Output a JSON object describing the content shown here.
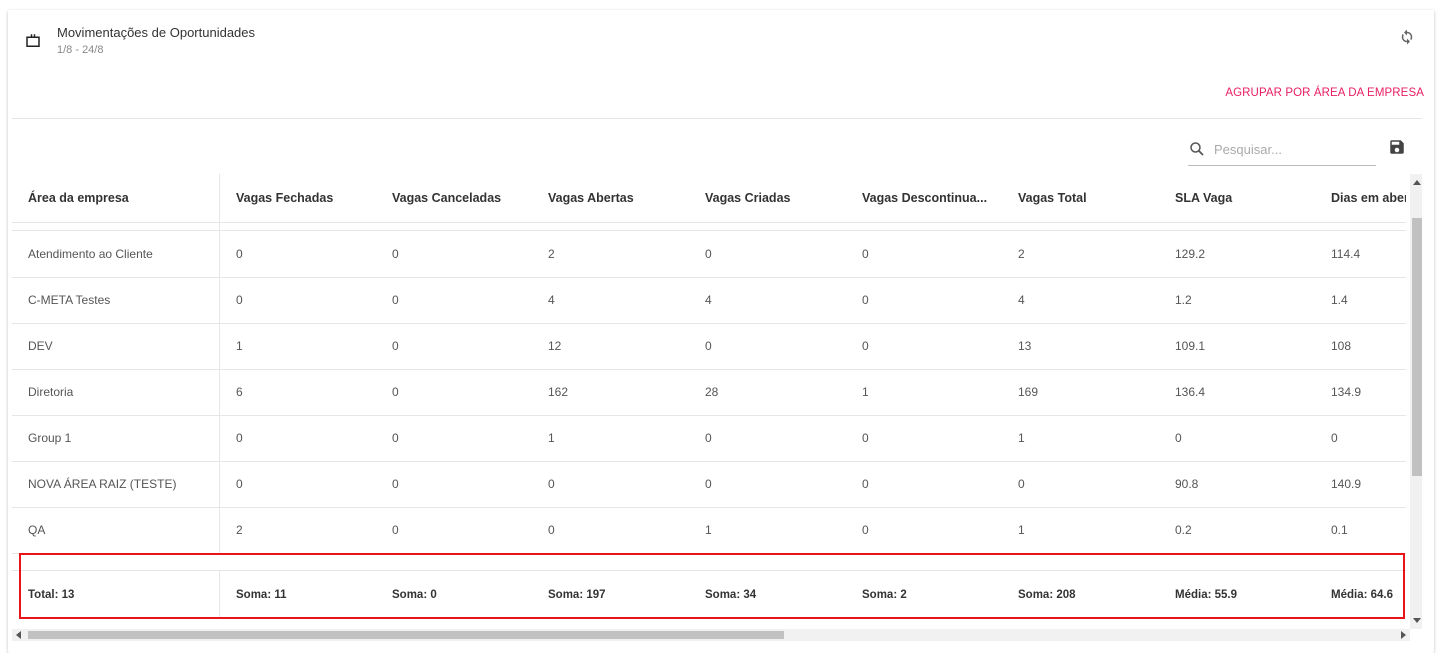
{
  "header": {
    "title": "Movimentações de Oportunidades",
    "date_range": "1/8 - 24/8",
    "group_button_label": "AGRUPAR POR ÁREA DA EMPRESA"
  },
  "search": {
    "placeholder": "Pesquisar...",
    "value": ""
  },
  "icons": {
    "header": "briefcase-icon",
    "refresh": "refresh-icon",
    "search": "search-icon",
    "save": "save-icon"
  },
  "colors": {
    "accent": "#e91e63",
    "highlight_box": "#e8141a"
  },
  "table": {
    "columns": [
      "Área da empresa",
      "Vagas Fechadas",
      "Vagas Canceladas",
      "Vagas Abertas",
      "Vagas Criadas",
      "Vagas Descontinua...",
      "Vagas Total",
      "SLA Vaga",
      "Dias em aberto"
    ],
    "rows": [
      [
        "Atendimento ao Cliente",
        "0",
        "0",
        "2",
        "0",
        "0",
        "2",
        "129.2",
        "114.4"
      ],
      [
        "C-META Testes",
        "0",
        "0",
        "4",
        "4",
        "0",
        "4",
        "1.2",
        "1.4"
      ],
      [
        "DEV",
        "1",
        "0",
        "12",
        "0",
        "0",
        "13",
        "109.1",
        "108"
      ],
      [
        "Diretoria",
        "6",
        "0",
        "162",
        "28",
        "1",
        "169",
        "136.4",
        "134.9"
      ],
      [
        "Group 1",
        "0",
        "0",
        "1",
        "0",
        "0",
        "1",
        "0",
        "0"
      ],
      [
        "NOVA ÁREA RAIZ (TESTE)",
        "0",
        "0",
        "0",
        "0",
        "0",
        "0",
        "90.8",
        "140.9"
      ],
      [
        "QA",
        "2",
        "0",
        "0",
        "1",
        "0",
        "1",
        "0.2",
        "0.1"
      ]
    ],
    "footer": [
      "Total: 13",
      "Soma: 11",
      "Soma: 0",
      "Soma: 197",
      "Soma: 34",
      "Soma: 2",
      "Soma: 208",
      "Média: 55.9",
      "Média: 64.6"
    ]
  }
}
